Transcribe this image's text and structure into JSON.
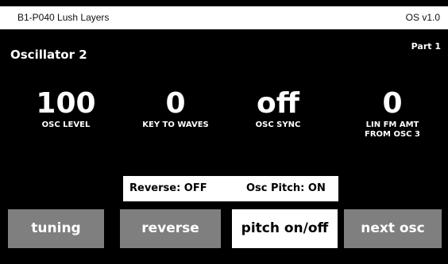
{
  "header": {
    "patch_name": "B1-P040 Lush Layers",
    "os_version": "OS v1.0"
  },
  "page": {
    "title": "Oscillator 2",
    "part": "Part 1"
  },
  "params": [
    {
      "value": "100",
      "label": "OSC LEVEL"
    },
    {
      "value": "0",
      "label": "KEY TO WAVES"
    },
    {
      "value": "off",
      "label": "OSC SYNC"
    },
    {
      "value": "0",
      "label": "LIN FM AMT\nFROM OSC 3"
    }
  ],
  "status": {
    "reverse": "Reverse: OFF",
    "osc_pitch": "Osc Pitch: ON"
  },
  "buttons": [
    {
      "label": "tuning",
      "selected": false
    },
    {
      "label": "reverse",
      "selected": false
    },
    {
      "label": "pitch on/off",
      "selected": true
    },
    {
      "label": "next osc",
      "selected": false
    }
  ]
}
